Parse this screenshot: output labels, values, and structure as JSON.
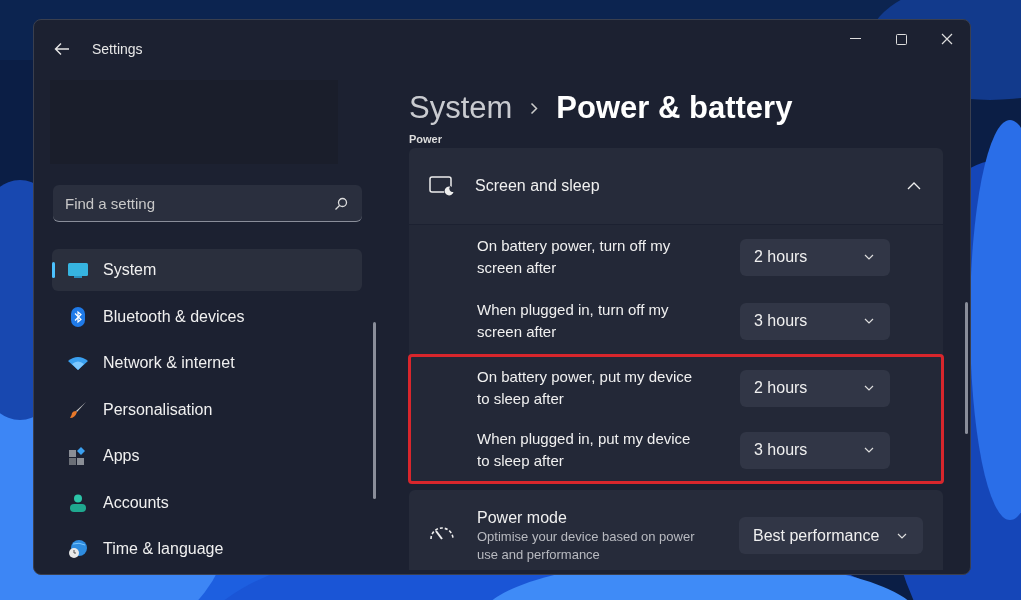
{
  "window": {
    "title": "Settings"
  },
  "search": {
    "placeholder": "Find a setting"
  },
  "sidebar": {
    "items": [
      {
        "label": "System",
        "selected": true
      },
      {
        "label": "Bluetooth & devices",
        "selected": false
      },
      {
        "label": "Network & internet",
        "selected": false
      },
      {
        "label": "Personalisation",
        "selected": false
      },
      {
        "label": "Apps",
        "selected": false
      },
      {
        "label": "Accounts",
        "selected": false
      },
      {
        "label": "Time & language",
        "selected": false
      }
    ]
  },
  "breadcrumb": {
    "parent": "System",
    "current": "Power & battery"
  },
  "section_heading": "Power",
  "screen_and_sleep": {
    "title": "Screen and sleep",
    "expanded": true,
    "rows": [
      {
        "label": "On battery power, turn off my screen after",
        "value": "2 hours",
        "highlighted": false
      },
      {
        "label": "When plugged in, turn off my screen after",
        "value": "3 hours",
        "highlighted": false
      },
      {
        "label": "On battery power, put my device to sleep after",
        "value": "2 hours",
        "highlighted": true
      },
      {
        "label": "When plugged in, put my device to sleep after",
        "value": "3 hours",
        "highlighted": true
      }
    ]
  },
  "power_mode": {
    "title": "Power mode",
    "description": "Optimise your device based on power use and performance",
    "value": "Best performance"
  }
}
